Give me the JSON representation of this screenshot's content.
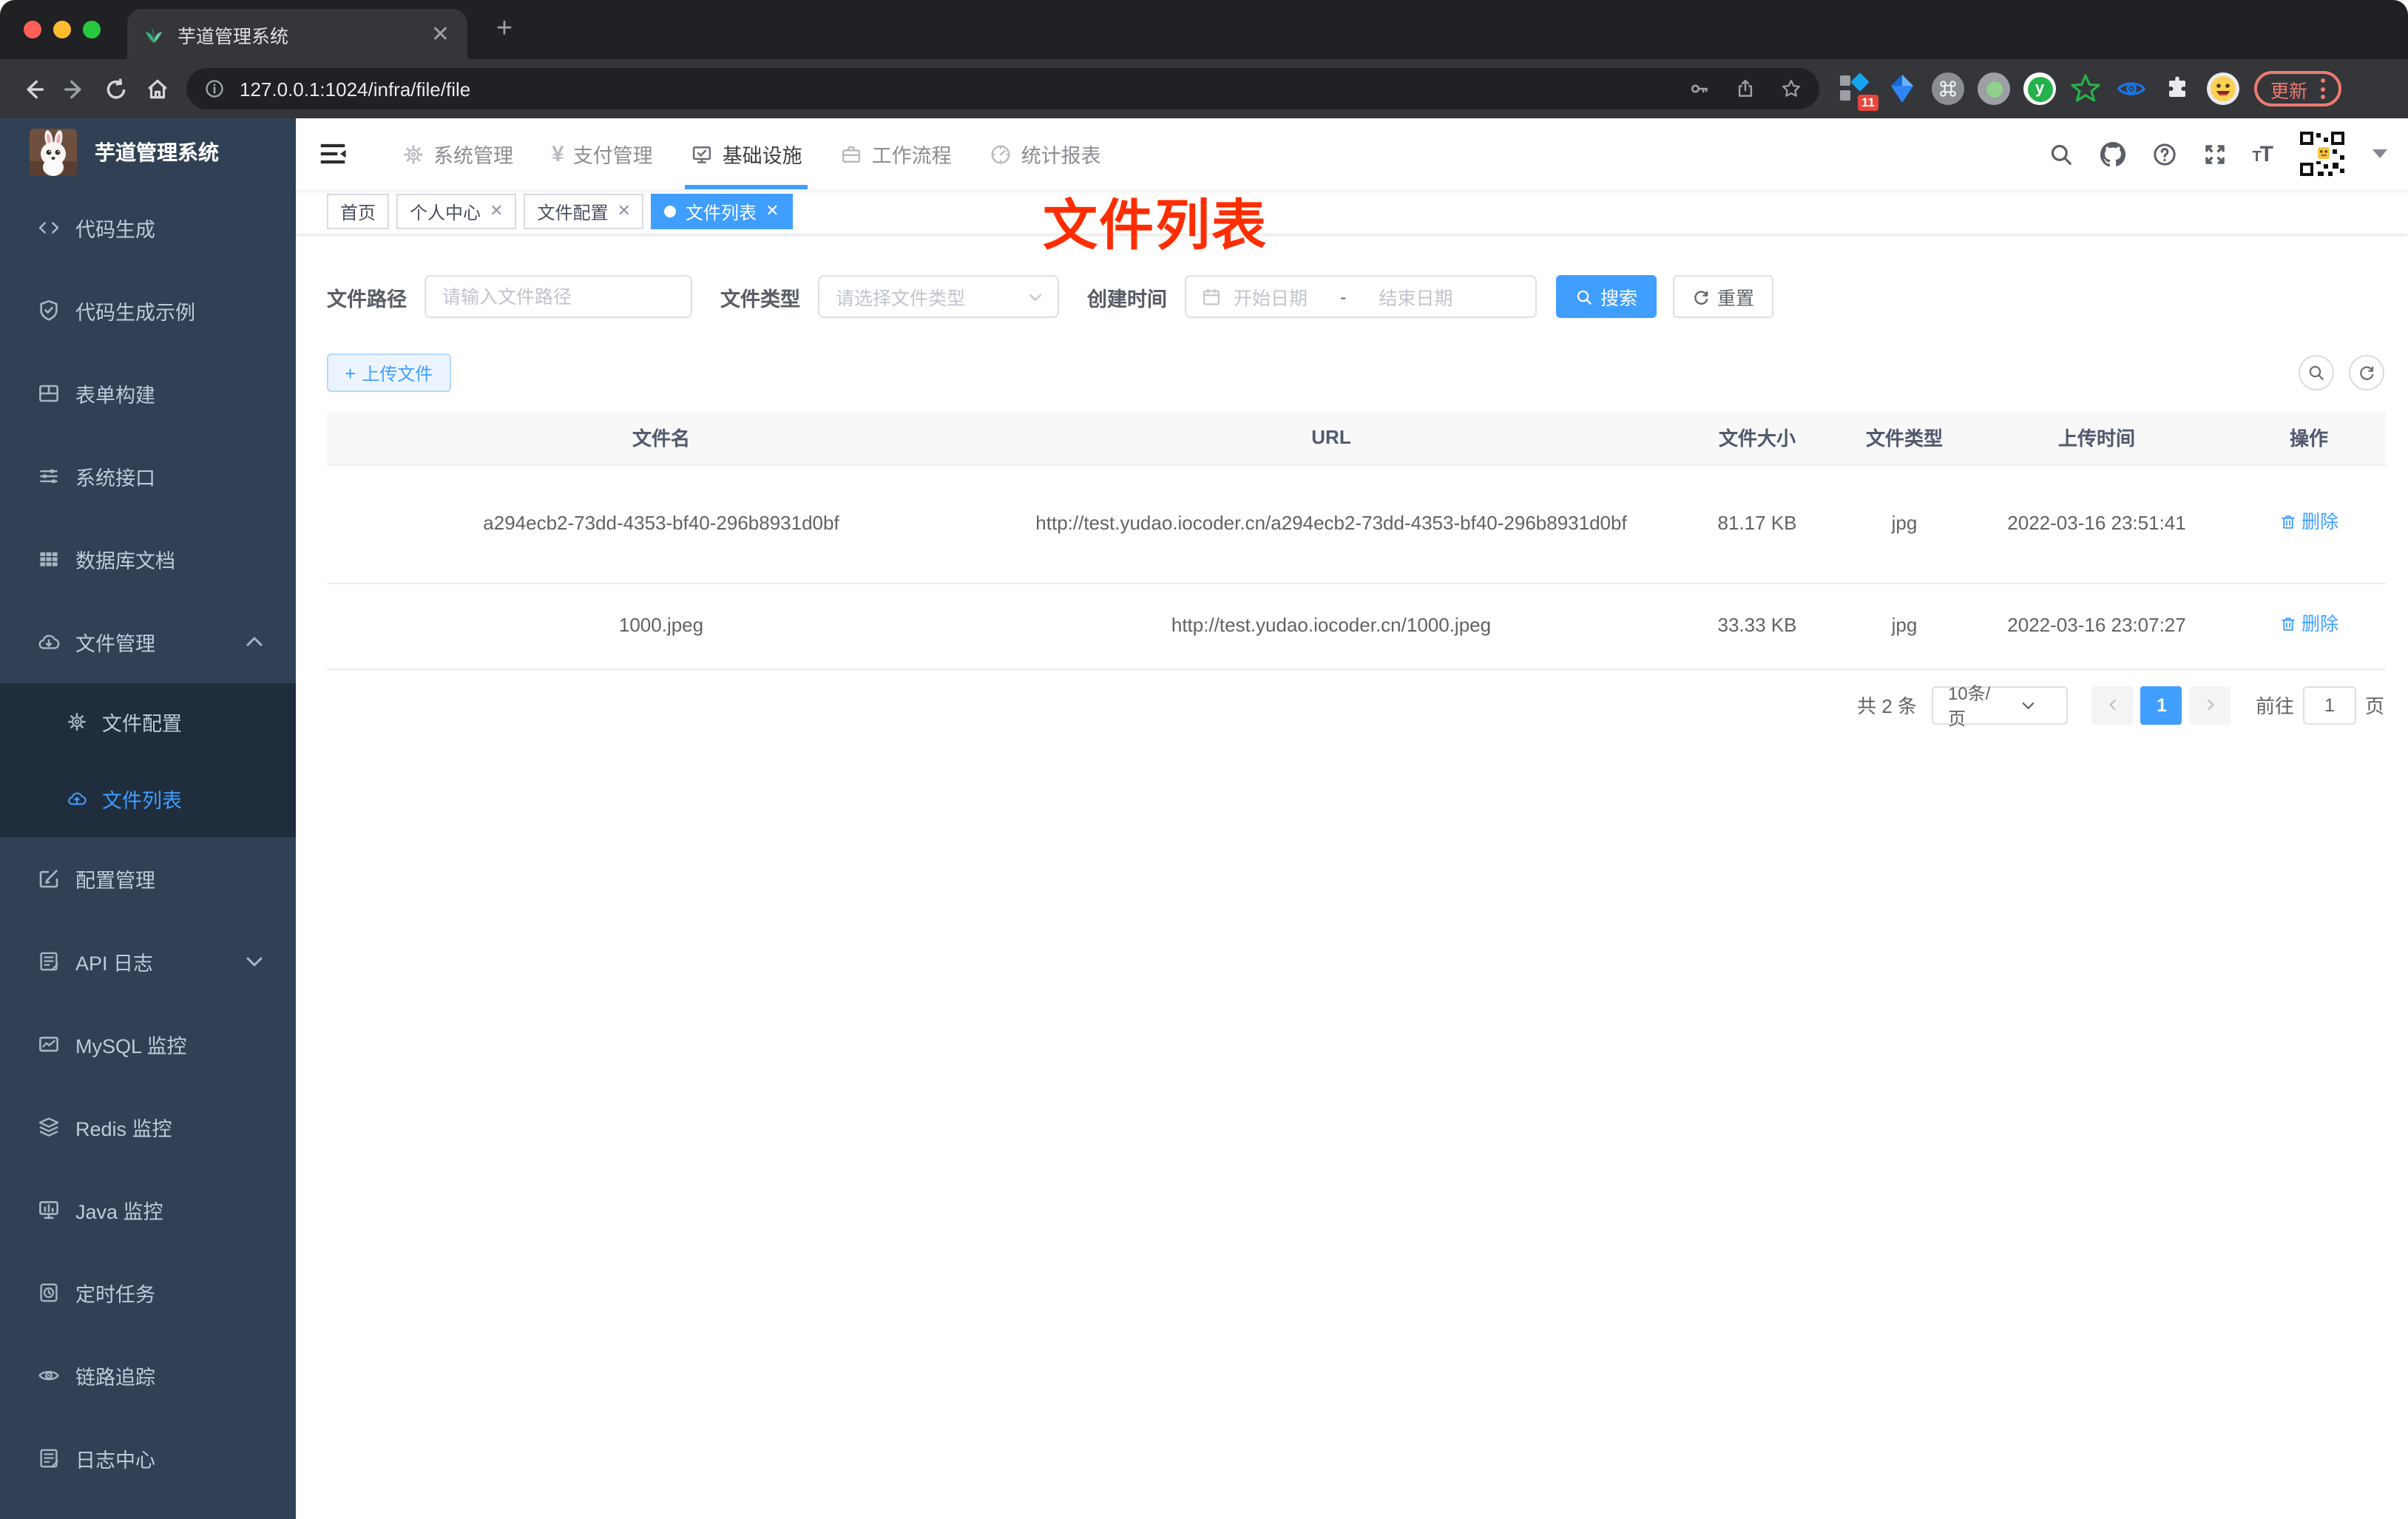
{
  "browser": {
    "tab_title": "芋道管理系统",
    "url": "127.0.0.1:1024/infra/file/file",
    "update_label": "更新",
    "ext_badge": "11"
  },
  "sidebar": {
    "title": "芋道管理系统",
    "items": [
      {
        "label": "代码生成"
      },
      {
        "label": "代码生成示例"
      },
      {
        "label": "表单构建"
      },
      {
        "label": "系统接口"
      },
      {
        "label": "数据库文档"
      },
      {
        "label": "文件管理"
      },
      {
        "label": "文件配置"
      },
      {
        "label": "文件列表"
      },
      {
        "label": "配置管理"
      },
      {
        "label": "API 日志"
      },
      {
        "label": "MySQL 监控"
      },
      {
        "label": "Redis 监控"
      },
      {
        "label": "Java 监控"
      },
      {
        "label": "定时任务"
      },
      {
        "label": "链路追踪"
      },
      {
        "label": "日志中心"
      }
    ]
  },
  "topnav": {
    "items": [
      {
        "label": "系统管理"
      },
      {
        "label": "支付管理"
      },
      {
        "label": "基础设施"
      },
      {
        "label": "工作流程"
      },
      {
        "label": "统计报表"
      }
    ]
  },
  "tags": {
    "items": [
      {
        "label": "首页"
      },
      {
        "label": "个人中心"
      },
      {
        "label": "文件配置"
      },
      {
        "label": "文件列表"
      }
    ]
  },
  "annotation": {
    "text": "文件列表",
    "color": "#ff2d00"
  },
  "filter": {
    "path_label": "文件路径",
    "path_placeholder": "请输入文件路径",
    "type_label": "文件类型",
    "type_placeholder": "请选择文件类型",
    "date_label": "创建时间",
    "date_start_placeholder": "开始日期",
    "date_separator": "-",
    "date_end_placeholder": "结束日期",
    "search_label": "搜索",
    "reset_label": "重置"
  },
  "toolbar": {
    "upload_label": "上传文件"
  },
  "table": {
    "columns": [
      "文件名",
      "URL",
      "文件大小",
      "文件类型",
      "上传时间",
      "操作"
    ],
    "rows": [
      {
        "name": "a294ecb2-73dd-4353-bf40-296b8931d0bf",
        "url": "http://test.yudao.iocoder.cn/a294ecb2-73dd-4353-bf40-296b8931d0bf",
        "size": "81.17 KB",
        "type": "jpg",
        "time": "2022-03-16 23:51:41",
        "action": "删除"
      },
      {
        "name": "1000.jpeg",
        "url": "http://test.yudao.iocoder.cn/1000.jpeg",
        "size": "33.33 KB",
        "type": "jpg",
        "time": "2022-03-16 23:07:27",
        "action": "删除"
      }
    ]
  },
  "pagination": {
    "total": "共 2 条",
    "page_size": "10条/页",
    "current_page": "1",
    "goto_label": "前往",
    "goto_value": "1",
    "page_unit": "页"
  },
  "colors": {
    "accent": "#409eff",
    "sidebar_bg": "#304156",
    "submenu_bg": "#1f2d3d",
    "annotation_red": "#ff2d00",
    "update_pill": "#ec7b70"
  }
}
